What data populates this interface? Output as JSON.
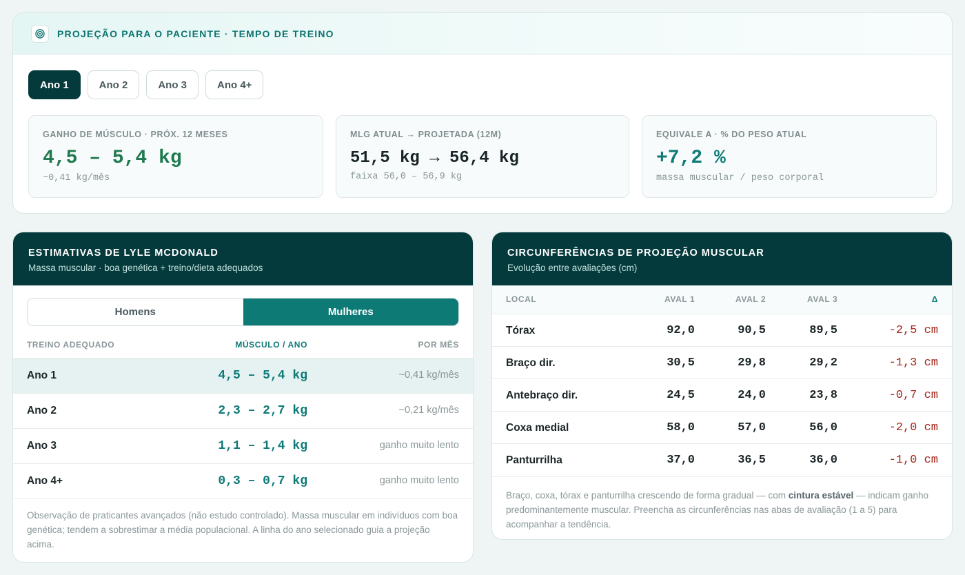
{
  "projection": {
    "title": "PROJEÇÃO PARA O PACIENTE · TEMPO DE TREINO",
    "icon": "target-icon",
    "tabs": [
      "Ano 1",
      "Ano 2",
      "Ano 3",
      "Ano 4+"
    ],
    "active_tab": "Ano 1",
    "metrics": [
      {
        "label": "GANHO DE MÚSCULO · PRÓX. 12 MESES",
        "value": "4,5 – 5,4 kg",
        "sub": "~0,41 kg/mês"
      },
      {
        "label": "MLG ATUAL → PROJETADA (12M)",
        "value": "51,5 kg → 56,4 kg",
        "sub": "faixa 56,0 – 56,9 kg"
      },
      {
        "label": "EQUIVALE A · % DO PESO ATUAL",
        "value": "+7,2 %",
        "sub": "massa muscular / peso corporal"
      }
    ]
  },
  "lyle": {
    "title": "ESTIMATIVAS DE LYLE MCDONALD",
    "subtitle": "Massa muscular · boa genética + treino/dieta adequados",
    "segments": [
      "Homens",
      "Mulheres"
    ],
    "active_segment": "Mulheres",
    "columns": [
      "TREINO ADEQUADO",
      "MÚSCULO / ANO",
      "POR MÊS"
    ],
    "rows": [
      {
        "year": "Ano 1",
        "range": "4,5 – 5,4 kg",
        "per_month": "~0,41 kg/mês"
      },
      {
        "year": "Ano 2",
        "range": "2,3 – 2,7 kg",
        "per_month": "~0,21 kg/mês"
      },
      {
        "year": "Ano 3",
        "range": "1,1 – 1,4 kg",
        "per_month": "ganho muito lento"
      },
      {
        "year": "Ano 4+",
        "range": "0,3 – 0,7 kg",
        "per_month": "ganho muito lento"
      }
    ],
    "note": "Observação de praticantes avançados (não estudo controlado). Massa muscular em indivíduos com boa genética; tendem a sobrestimar a média populacional. A linha do ano selecionado guia a projeção acima."
  },
  "circ": {
    "title": "CIRCUNFERÊNCIAS DE PROJEÇÃO MUSCULAR",
    "subtitle": "Evolução entre avaliações (cm)",
    "columns": [
      "LOCAL",
      "AVAL 1",
      "AVAL 2",
      "AVAL 3",
      "Δ"
    ],
    "rows": [
      {
        "local": "Tórax",
        "a1": "92,0",
        "a2": "90,5",
        "a3": "89,5",
        "delta": "-2,5 cm"
      },
      {
        "local": "Braço dir.",
        "a1": "30,5",
        "a2": "29,8",
        "a3": "29,2",
        "delta": "-1,3 cm"
      },
      {
        "local": "Antebraço dir.",
        "a1": "24,5",
        "a2": "24,0",
        "a3": "23,8",
        "delta": "-0,7 cm"
      },
      {
        "local": "Coxa medial",
        "a1": "58,0",
        "a2": "57,0",
        "a3": "56,0",
        "delta": "-2,0 cm"
      },
      {
        "local": "Panturrilha",
        "a1": "37,0",
        "a2": "36,5",
        "a3": "36,0",
        "delta": "-1,0 cm"
      }
    ],
    "note_pre": "Braço, coxa, tórax e panturrilha crescendo de forma gradual — com ",
    "note_bold": "cintura estável",
    "note_post": " — indicam ganho predominantemente muscular. Preencha as circunferências nas abas de avaliação (1 a 5) para acompanhar a tendência."
  }
}
